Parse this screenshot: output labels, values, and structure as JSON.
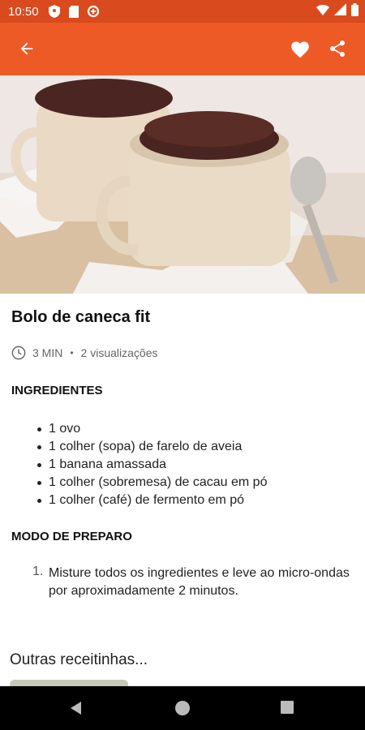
{
  "status_bar": {
    "time": "10:50"
  },
  "toolbar": {
    "back_icon": "arrow-left-icon",
    "favorite_icon": "heart-icon",
    "share_icon": "share-icon"
  },
  "recipe": {
    "title": "Bolo de caneca fit",
    "time": "3 MIN",
    "separator": "•",
    "views": "2 visualizações",
    "ingredients_heading": "INGREDIENTES",
    "ingredients": [
      "1 ovo",
      "1 colher (sopa) de farelo de aveia",
      "1 banana amassada",
      "1 colher (sobremesa) de cacau em pó",
      "1 colher (café) de fermento em pó"
    ],
    "preparation_heading": "MODO DE PREPARO",
    "steps": [
      {
        "number": "1.",
        "text": "Misture todos os ingredientes e leve ao micro-ondas por aproximadamente 2 minutos."
      }
    ]
  },
  "more_section": {
    "title": "Outras receitinhas..."
  },
  "colors": {
    "status_bar": "#d94a1f",
    "toolbar": "#ee5a26"
  }
}
